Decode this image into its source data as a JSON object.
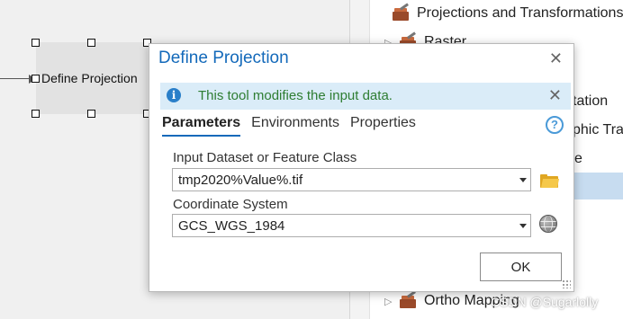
{
  "canvas": {
    "node_label": "Define Projection"
  },
  "toolbox": {
    "items": [
      {
        "label": "Projections and Transformations",
        "expanded": true,
        "icon": "toolbox-icon"
      },
      {
        "label": "Raster",
        "expanded": false,
        "icon": "toolbox-icon"
      },
      {
        "label": "Ortho Mapping",
        "expanded": false,
        "icon": "toolbox-icon"
      }
    ],
    "partial_labels": [
      "tation",
      "phic Tra",
      "e"
    ]
  },
  "dialog": {
    "title": "Define Projection",
    "close_icon": "close-icon",
    "info": {
      "icon": "info-icon",
      "text": "This tool modifies the input data."
    },
    "tabs": [
      "Parameters",
      "Environments",
      "Properties"
    ],
    "active_tab": "Parameters",
    "help_icon": "help-icon",
    "help_glyph": "?",
    "fields": {
      "input": {
        "label": "Input Dataset or Feature Class",
        "value": "tmp2020%Value%.tif",
        "action_icon": "folder-icon"
      },
      "coordinate_system": {
        "label": "Coordinate System",
        "value": "GCS_WGS_1984",
        "action_icon": "globe-icon"
      }
    },
    "ok_label": "OK"
  },
  "watermark": "CSDN @Sugarlolly",
  "colors": {
    "title_blue": "#1369ba",
    "info_bg": "#daecf8",
    "info_text": "#2e7d32",
    "selection": "#c7dcf0"
  }
}
